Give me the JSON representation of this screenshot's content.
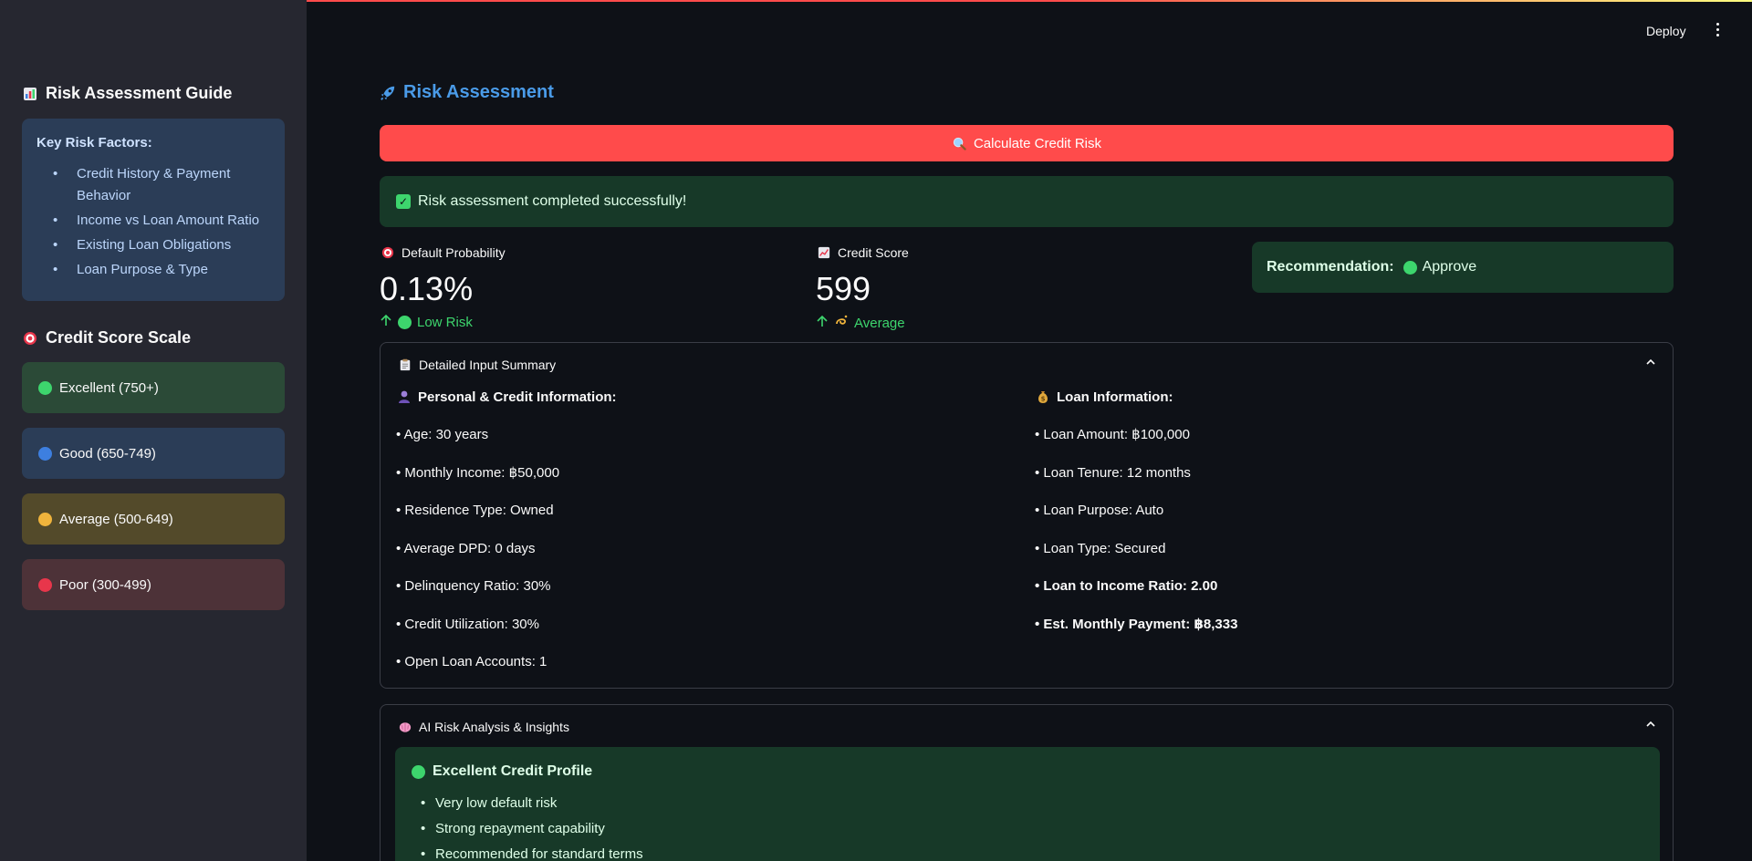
{
  "header": {
    "deploy_label": "Deploy",
    "menu_icon": "kebab-menu-icon"
  },
  "sidebar": {
    "guide_heading": "Risk Assessment Guide",
    "guide_icon": "bar-chart-icon",
    "factors_title": "Key Risk Factors:",
    "factors": [
      "Credit History & Payment Behavior",
      "Income vs Loan Amount Ratio",
      "Existing Loan Obligations",
      "Loan Purpose & Type"
    ],
    "scale_heading": "Credit Score Scale",
    "scale_icon": "target-icon",
    "scale": [
      {
        "label": "Excellent (750+)",
        "dot_color": "#3dd56d",
        "bg": "#2b4a37"
      },
      {
        "label": "Good (650-749)",
        "dot_color": "#3d7fe0",
        "bg": "#2b3d57"
      },
      {
        "label": "Average (500-649)",
        "dot_color": "#f0b43c",
        "bg": "#534a2a"
      },
      {
        "label": "Poor (300-499)",
        "dot_color": "#e8364b",
        "bg": "#4d3238"
      }
    ]
  },
  "main": {
    "title": "Risk Assessment",
    "title_icon": "rocket-icon",
    "calc_button": "Calculate Credit Risk",
    "calc_icon": "magnifier-icon",
    "success_message": "Risk assessment completed successfully!",
    "metrics": {
      "default_probability": {
        "label": "Default Probability",
        "value": "0.13%",
        "delta": "Low Risk"
      },
      "credit_score": {
        "label": "Credit Score",
        "value": "599",
        "delta": "Average"
      }
    },
    "recommendation": {
      "label": "Recommendation:",
      "value": "Approve"
    },
    "summary": {
      "title": "Detailed Input Summary",
      "personal_title": "Personal & Credit Information:",
      "personal": [
        "• Age: 30 years",
        "• Monthly Income: ฿50,000",
        "• Residence Type: Owned",
        "• Average DPD: 0 days",
        "• Delinquency Ratio: 30%",
        "• Credit Utilization: 30%",
        "• Open Loan Accounts: 1"
      ],
      "loan_title": "Loan Information:",
      "loan": [
        "• Loan Amount: ฿100,000",
        "• Loan Tenure: 12 months",
        "• Loan Purpose: Auto",
        "• Loan Type: Secured",
        "• Loan to Income Ratio: 2.00",
        "• Est. Monthly Payment: ฿8,333"
      ]
    },
    "insights": {
      "title": "AI Risk Analysis & Insights",
      "profile_title": "Excellent Credit Profile",
      "points": [
        "Very low default risk",
        "Strong repayment capability",
        "Recommended for standard terms"
      ]
    }
  },
  "colors": {
    "accent": "#ff4b4b",
    "success": "#3dd56d",
    "title_blue": "#4a9be8"
  }
}
